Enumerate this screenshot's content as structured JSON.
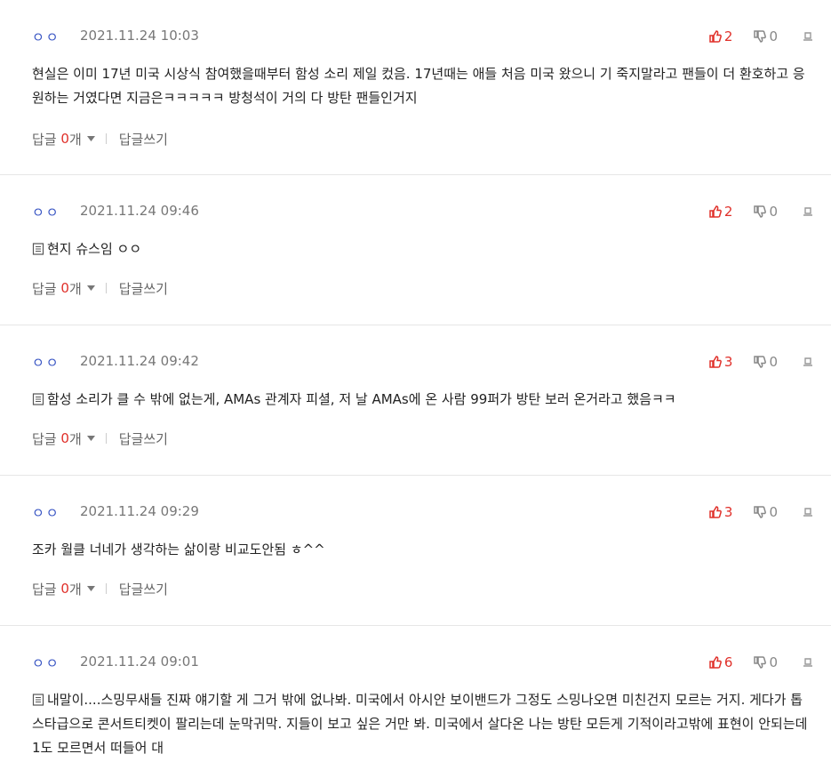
{
  "comments": [
    {
      "nick": "ㅇㅇ",
      "date": "2021.11.24 10:03",
      "up": "2",
      "down": "0",
      "has_memo": false,
      "text": "현실은 이미 17년 미국 시상식 참여했을때부터 함성 소리 제일 컸음. 17년때는 애들 처음 미국 왔으니 기 죽지말라고 팬들이 더 환호하고 응원하는 거였다면 지금은ㅋㅋㅋㅋㅋ 방청석이 거의 다 방탄 팬들인거지",
      "reply_label": "답글",
      "reply_count": "0",
      "reply_unit": "개",
      "write_label": "답글쓰기"
    },
    {
      "nick": "ㅇㅇ",
      "date": "2021.11.24 09:46",
      "up": "2",
      "down": "0",
      "has_memo": true,
      "text": "현지 슈스임 ㅇㅇ",
      "reply_label": "답글",
      "reply_count": "0",
      "reply_unit": "개",
      "write_label": "답글쓰기"
    },
    {
      "nick": "ㅇㅇ",
      "date": "2021.11.24 09:42",
      "up": "3",
      "down": "0",
      "has_memo": true,
      "text": "함성 소리가 클 수 밖에 없는게, AMAs 관계자 피셜, 저 날 AMAs에 온 사람 99퍼가 방탄 보러 온거라고 했음ㅋㅋ",
      "reply_label": "답글",
      "reply_count": "0",
      "reply_unit": "개",
      "write_label": "답글쓰기"
    },
    {
      "nick": "ㅇㅇ",
      "date": "2021.11.24 09:29",
      "up": "3",
      "down": "0",
      "has_memo": false,
      "text": "조카 월클 너네가 생각하는 삶이랑 비교도안됨 ㅎ^^",
      "reply_label": "답글",
      "reply_count": "0",
      "reply_unit": "개",
      "write_label": "답글쓰기"
    },
    {
      "nick": "ㅇㅇ",
      "date": "2021.11.24 09:01",
      "up": "6",
      "down": "0",
      "has_memo": true,
      "text": "내말이....스밍무새들 진짜 얘기할 게 그거 밖에 없나봐. 미국에서 아시안 보이밴드가 그정도 스밍나오면 미친건지 모르는 거지. 게다가 톱스타급으로 콘서트티켓이 팔리는데 눈막귀막. 지들이 보고 싶은 거만 봐. 미국에서 살다온 나는 방탄 모든게 기적이라고밖에 표현이 안되는데 1도 모르면서 떠들어 대",
      "reply_label": "",
      "reply_count": "",
      "reply_unit": "",
      "write_label": ""
    }
  ],
  "colors": {
    "accent_red": "#e0302a",
    "nick_blue": "#3b57c4",
    "muted": "#777777"
  },
  "icons": [
    "thumbs-up-icon",
    "thumbs-down-icon",
    "report-icon",
    "memo-icon",
    "caret-down-icon"
  ]
}
